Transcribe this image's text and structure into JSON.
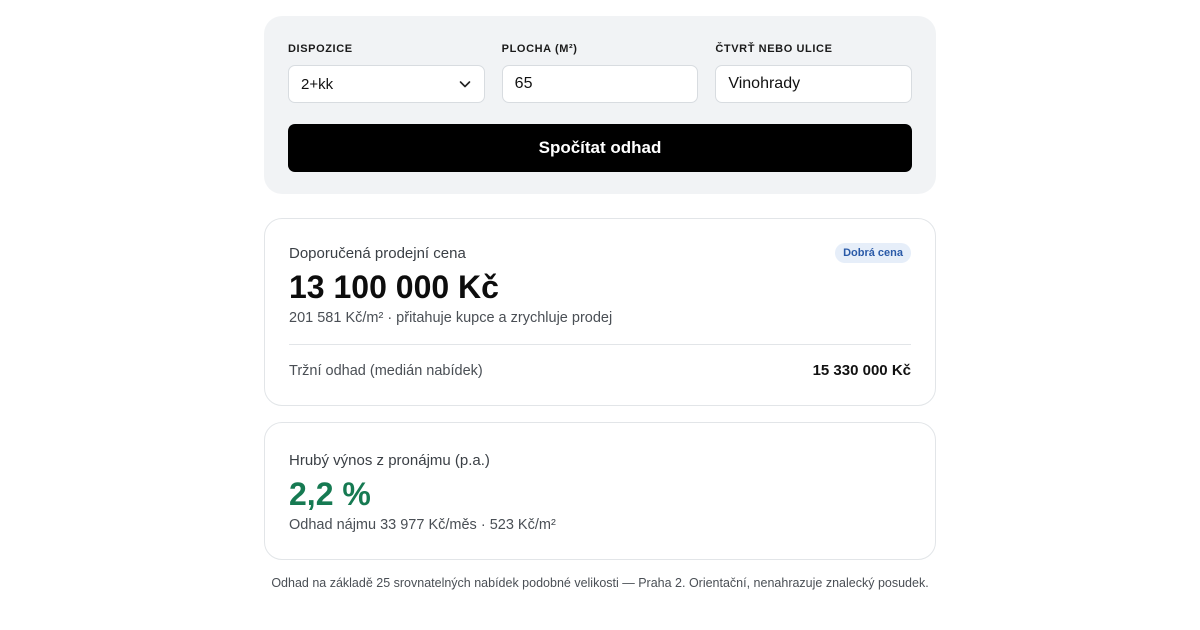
{
  "form": {
    "dispozice": {
      "label": "DISPOZICE",
      "value": "2+kk"
    },
    "plocha": {
      "label": "PLOCHA (M²)",
      "value": "65"
    },
    "lokalita": {
      "label": "ČTVRŤ NEBO ULICE",
      "value": "Vinohrady"
    },
    "submit_label": "Spočítat odhad"
  },
  "price": {
    "label": "Doporučená prodejní cena",
    "badge": "Dobrá cena",
    "value": "13 100 000 Kč",
    "detail": "201 581 Kč/m² · přitahuje kupce a zrychluje prodej",
    "market_label": "Tržní odhad (medián nabídek)",
    "market_value": "15 330 000 Kč"
  },
  "yield": {
    "label": "Hrubý výnos z pronájmu (p.a.)",
    "value": "2,2 %",
    "detail": "Odhad nájmu 33 977 Kč/měs · 523 Kč/m²"
  },
  "footnote": "Odhad na základě 25 srovnatelných nabídek podobné velikosti — Praha 2. Orientační, nenahrazuje znalecký posudek.",
  "colors": {
    "accent_green": "#167a52",
    "badge_blue": "#2a5aa8",
    "badge_bg": "#e6eef9",
    "form_bg": "#f1f3f5",
    "button_bg": "#000000"
  },
  "icons": {
    "select_arrow": "chevron-down-icon"
  }
}
